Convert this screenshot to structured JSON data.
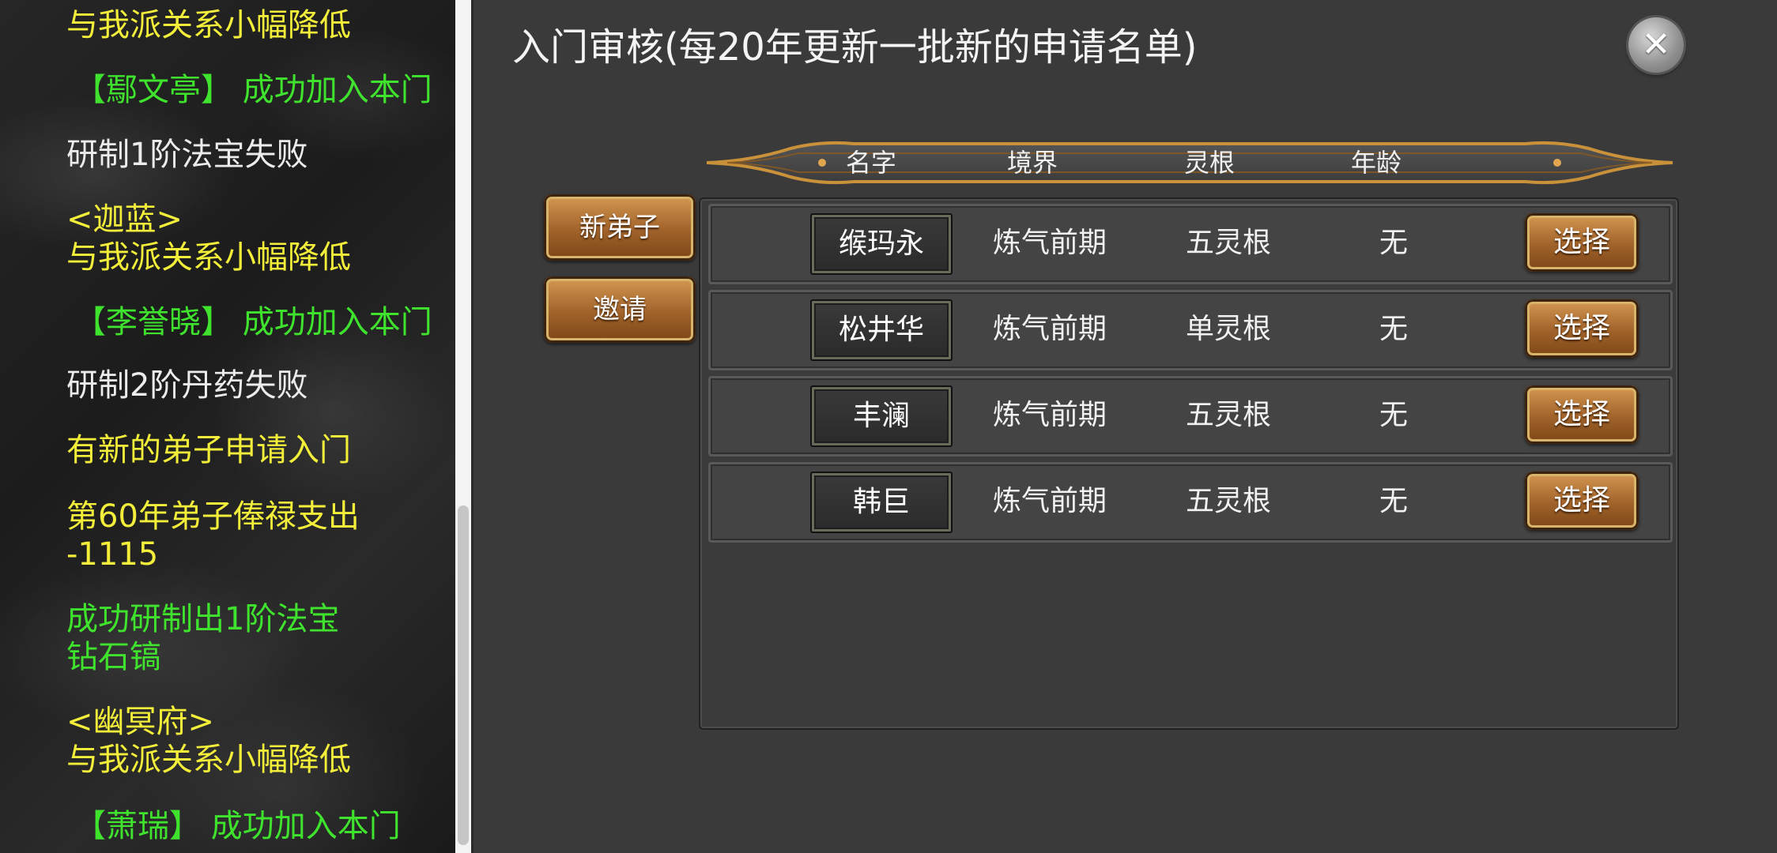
{
  "log": [
    {
      "kind": "yellow",
      "lines": [
        "与我派关系小幅降低"
      ]
    },
    {
      "kind": "green",
      "lines": [
        "【鄢文亭】 成功加入本门"
      ]
    },
    {
      "kind": "white",
      "lines": [
        "研制1阶法宝失败"
      ]
    },
    {
      "kind": "yellow",
      "lines": [
        "<迦蓝>",
        "与我派关系小幅降低"
      ]
    },
    {
      "kind": "green",
      "lines": [
        "【李誉晓】 成功加入本门"
      ]
    },
    {
      "kind": "white",
      "lines": [
        "研制2阶丹药失败"
      ]
    },
    {
      "kind": "yellow",
      "lines": [
        "有新的弟子申请入门"
      ]
    },
    {
      "kind": "yellow",
      "lines": [
        "第60年弟子俸禄支出",
        "-1115"
      ]
    },
    {
      "kind": "green",
      "lines": [
        "成功研制出1阶法宝",
        "钻石镐"
      ]
    },
    {
      "kind": "yellow",
      "lines": [
        "<幽冥府>",
        "与我派关系小幅降低"
      ]
    },
    {
      "kind": "green",
      "lines": [
        "【萧瑞】 成功加入本门"
      ]
    }
  ],
  "dialog": {
    "title": "入门审核(每20年更新一批新的申请名单)",
    "close_icon": "✕",
    "side_buttons": {
      "new_disciples": "新弟子",
      "invite": "邀请"
    },
    "columns": {
      "name": "名字",
      "realm": "境界",
      "spirit_root": "灵根",
      "age": "年龄"
    },
    "rows": [
      {
        "name": "缑玛永",
        "realm": "炼气前期",
        "spirit_root": "五灵根",
        "age": "无",
        "action": "选择"
      },
      {
        "name": "松井华",
        "realm": "炼气前期",
        "spirit_root": "单灵根",
        "age": "无",
        "action": "选择"
      },
      {
        "name": "丰澜",
        "realm": "炼气前期",
        "spirit_root": "五灵根",
        "age": "无",
        "action": "选择"
      },
      {
        "name": "韩巨",
        "realm": "炼气前期",
        "spirit_root": "五灵根",
        "age": "无",
        "action": "选择"
      }
    ]
  },
  "colors": {
    "log_yellow": "#f2ee3a",
    "log_green": "#3fe32e",
    "log_white": "#ececec",
    "button_gold": "#a0622a"
  }
}
